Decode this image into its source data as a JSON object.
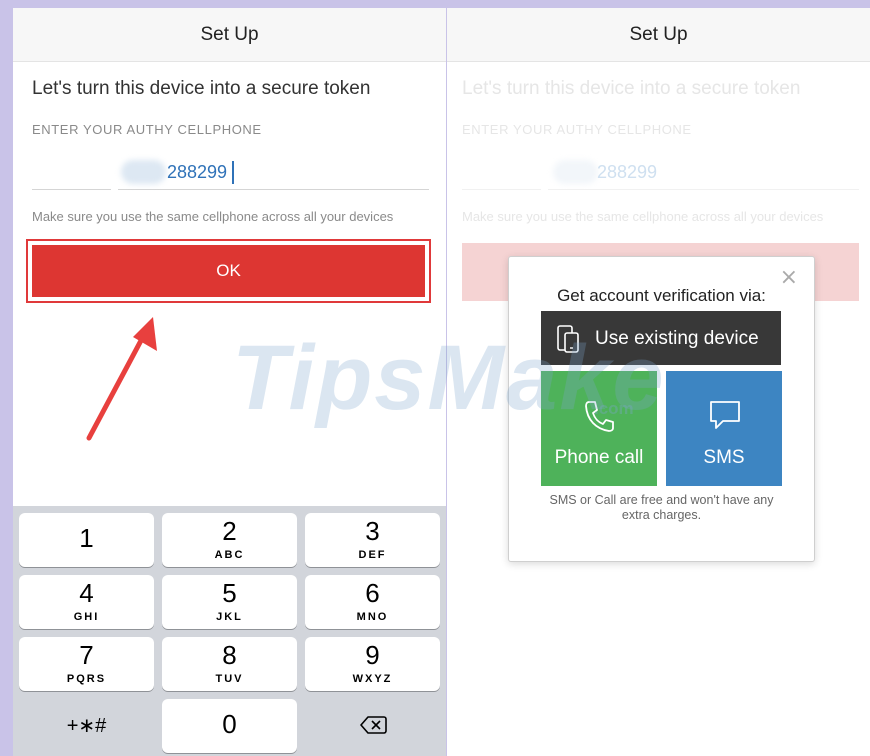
{
  "left": {
    "nav_title": "Set Up",
    "heading": "Let's turn this device into a secure token",
    "field_label": "ENTER YOUR AUTHY CELLPHONE",
    "phone_value": "288299",
    "hint": "Make sure you use the same cellphone across all your devices",
    "ok_label": "OK"
  },
  "keyboard": {
    "keys": [
      {
        "num": "1",
        "letters": ""
      },
      {
        "num": "2",
        "letters": "ABC"
      },
      {
        "num": "3",
        "letters": "DEF"
      },
      {
        "num": "4",
        "letters": "GHI"
      },
      {
        "num": "5",
        "letters": "JKL"
      },
      {
        "num": "6",
        "letters": "MNO"
      },
      {
        "num": "7",
        "letters": "PQRS"
      },
      {
        "num": "8",
        "letters": "TUV"
      },
      {
        "num": "9",
        "letters": "WXYZ"
      },
      {
        "num": "0",
        "letters": ""
      }
    ],
    "symbols_label": "+∗#",
    "backspace_icon": "backspace-icon"
  },
  "right": {
    "nav_title": "Set Up",
    "heading": "Let's turn this device into a secure token",
    "field_label": "ENTER YOUR AUTHY CELLPHONE",
    "phone_value": "288299",
    "hint": "Make sure you use the same cellphone across all your devices"
  },
  "dialog": {
    "close_label": "×",
    "title": "Get account verification via:",
    "existing_label": "Use existing device",
    "phone_call_label": "Phone call",
    "sms_label": "SMS",
    "note": "SMS or Call are free and won't have any extra charges."
  },
  "watermark": {
    "main": "TipsMake",
    "sub": ".com"
  },
  "colors": {
    "ok_red": "#dd3632",
    "phone_green": "#4eb25a",
    "sms_blue": "#3d85c2",
    "existing_dark": "#383838",
    "link_blue": "#2f72b8"
  }
}
